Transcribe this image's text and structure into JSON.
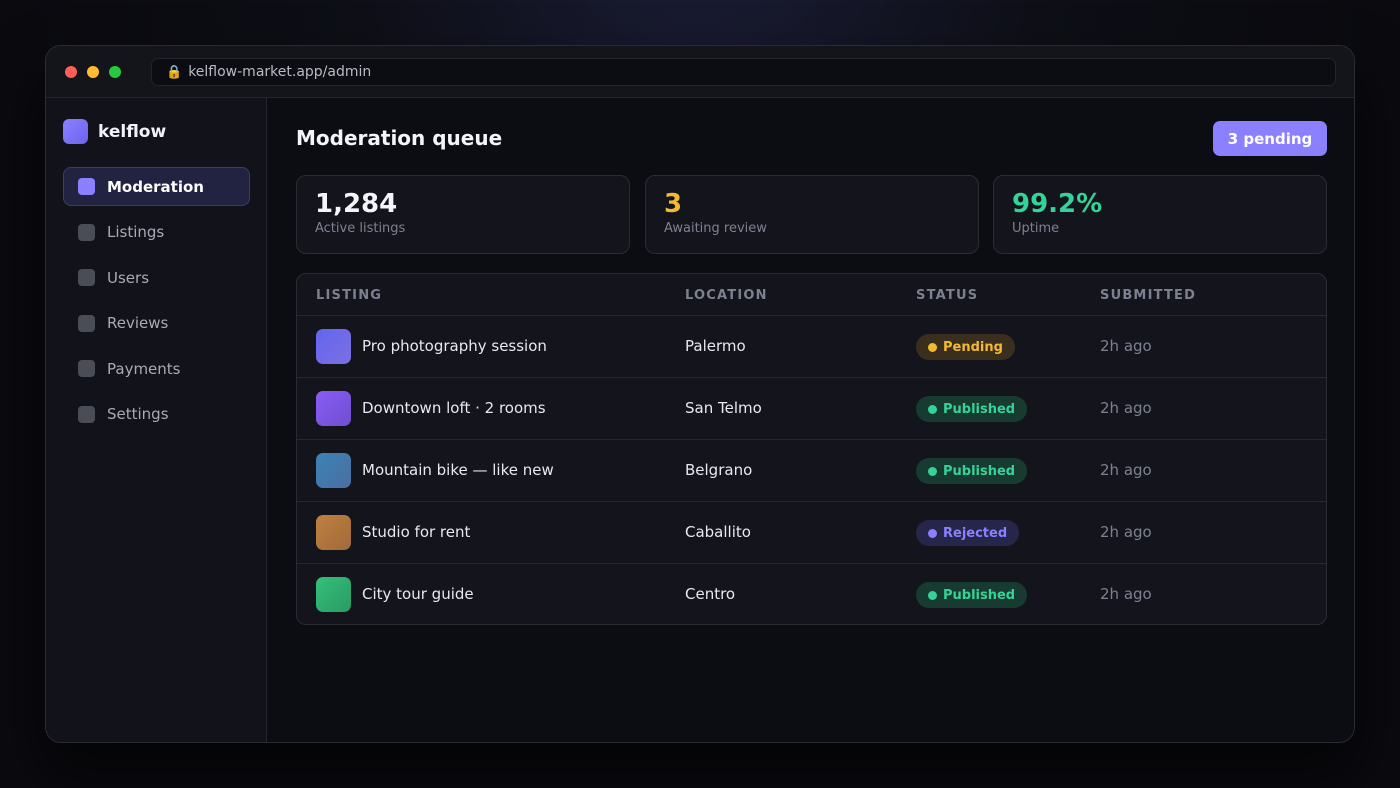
{
  "browser": {
    "url": "kelflow-market.app/admin",
    "colors": {
      "close": "#ff5f57",
      "minimize": "#febc2e",
      "maximize": "#28c840"
    }
  },
  "sidebar": {
    "brand": "kelflow",
    "items": [
      {
        "label": "Moderation",
        "active": true
      },
      {
        "label": "Listings",
        "active": false
      },
      {
        "label": "Users",
        "active": false
      },
      {
        "label": "Reviews",
        "active": false
      },
      {
        "label": "Payments",
        "active": false
      },
      {
        "label": "Settings",
        "active": false
      }
    ]
  },
  "header": {
    "title": "Moderation queue",
    "pending_label": "3 pending"
  },
  "stats": [
    {
      "value": "1,284",
      "label": "Active listings",
      "color": "#f4f5fa"
    },
    {
      "value": "3",
      "label": "Awaiting review",
      "color": "#f5b92e"
    },
    {
      "value": "99.2%",
      "label": "Uptime",
      "color": "#34d399"
    }
  ],
  "table": {
    "columns": [
      "LISTING",
      "LOCATION",
      "STATUS",
      "SUBMITTED"
    ],
    "rows": [
      {
        "listing": "Pro photography session",
        "location": "Palermo",
        "status": "Pending",
        "submitted": "2h ago",
        "thumb": [
          "#6366f1",
          "#7c6fe0"
        ]
      },
      {
        "listing": "Downtown loft · 2 rooms",
        "location": "San Telmo",
        "status": "Published",
        "submitted": "2h ago",
        "thumb": [
          "#8b5cf6",
          "#6d4fd0"
        ]
      },
      {
        "listing": "Mountain bike — like new",
        "location": "Belgrano",
        "status": "Published",
        "submitted": "2h ago",
        "thumb": [
          "#3b82b6",
          "#4a6fa0"
        ]
      },
      {
        "listing": "Studio for rent",
        "location": "Caballito",
        "status": "Rejected",
        "submitted": "2h ago",
        "thumb": [
          "#c08040",
          "#a06a3a"
        ]
      },
      {
        "listing": "City tour guide",
        "location": "Centro",
        "status": "Published",
        "submitted": "2h ago",
        "thumb": [
          "#34c07a",
          "#2a9a65"
        ]
      }
    ]
  },
  "status_styles": {
    "Pending": {
      "bg": "#3a2e1e",
      "fg": "#f5b92e"
    },
    "Published": {
      "bg": "#173b30",
      "fg": "#34d399"
    },
    "Rejected": {
      "bg": "#26264a",
      "fg": "#8b80ff"
    }
  }
}
